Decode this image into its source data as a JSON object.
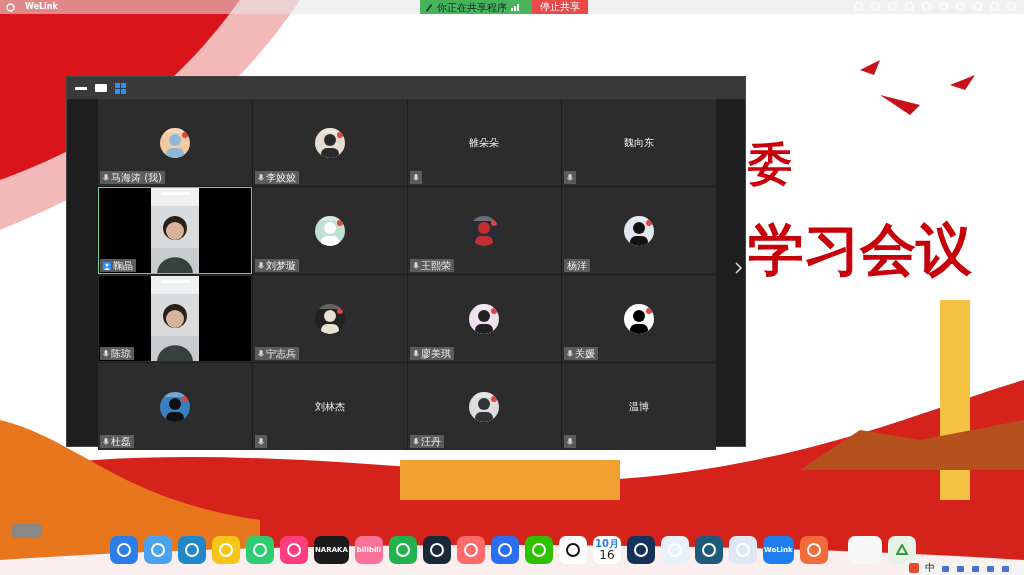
{
  "top_bar": {
    "app_name": "WeLink",
    "sharing_status": "你正在共享程序",
    "stop_button": "停止共享"
  },
  "slide": {
    "lines": [
      "委",
      "学习会议"
    ]
  },
  "meeting": {
    "tiles": [
      {
        "kind": "avatar",
        "name": "马海涛 (我)",
        "mic": true,
        "selected": false
      },
      {
        "kind": "avatar",
        "name": "李姣姣",
        "mic": true,
        "selected": false
      },
      {
        "kind": "text",
        "name": "雒朵朵",
        "mic": true,
        "selected": false
      },
      {
        "kind": "text",
        "name": "魏向东",
        "mic": true,
        "selected": false
      },
      {
        "kind": "video",
        "name": "鞠晶",
        "mic": false,
        "selected": true
      },
      {
        "kind": "avatar",
        "name": "刘梦璇",
        "mic": true,
        "selected": false
      },
      {
        "kind": "avatar",
        "name": "王熙荣",
        "mic": true,
        "selected": false
      },
      {
        "kind": "avatar",
        "name": "杨洋",
        "mic": false,
        "selected": false
      },
      {
        "kind": "video",
        "name": "陈琼",
        "mic": true,
        "selected": false
      },
      {
        "kind": "avatar",
        "name": "宁志兵",
        "mic": true,
        "selected": false
      },
      {
        "kind": "avatar",
        "name": "廖美琪",
        "mic": true,
        "selected": false
      },
      {
        "kind": "avatar",
        "name": "关媛",
        "mic": true,
        "selected": false
      },
      {
        "kind": "avatar",
        "name": "杜磊",
        "mic": true,
        "selected": false
      },
      {
        "kind": "text",
        "name": "刘林杰",
        "mic": true,
        "selected": false
      },
      {
        "kind": "avatar",
        "name": "汪丹",
        "mic": true,
        "selected": false
      },
      {
        "kind": "text",
        "name": "温博",
        "mic": true,
        "selected": false
      }
    ]
  },
  "dock": {
    "naraka": "NARAKA",
    "bilibili": "bilibili",
    "calendar_month": "10月",
    "calendar_day": "16",
    "welink": "WeLink"
  },
  "tray": {
    "input_method": "中"
  }
}
